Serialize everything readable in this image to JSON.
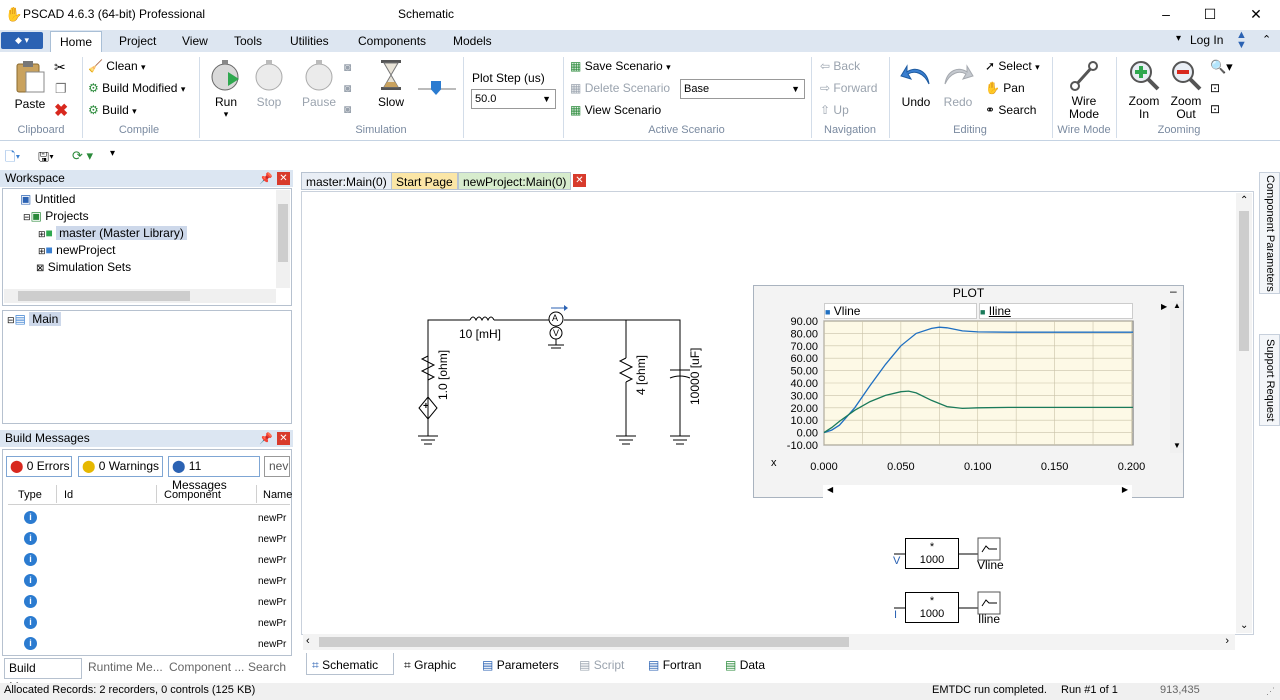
{
  "window": {
    "title": "PSCAD 4.6.3 (64-bit) Professional",
    "document": "Schematic",
    "minimize": "–",
    "maximize": "☐",
    "close": "✕"
  },
  "ribbon_tabs": [
    "Home",
    "Project",
    "View",
    "Tools",
    "Utilities",
    "Components",
    "Models"
  ],
  "login": "Log In",
  "ribbon": {
    "clipboard": {
      "paste": "Paste",
      "group": "Clipboard"
    },
    "compile": {
      "clean": "Clean",
      "build_modified": "Build Modified",
      "build": "Build",
      "group": "Compile"
    },
    "simulation": {
      "run": "Run",
      "stop": "Stop",
      "pause": "Pause",
      "slow": "Slow",
      "group": "Simulation"
    },
    "plot_step": {
      "label": "Plot Step (us)",
      "value": "50.0"
    },
    "scenario": {
      "save": "Save Scenario",
      "delete": "Delete Scenario",
      "view": "View Scenario",
      "value": "Base",
      "group": "Active Scenario"
    },
    "navigation": {
      "back": "Back",
      "forward": "Forward",
      "up": "Up",
      "group": "Navigation"
    },
    "editing": {
      "undo": "Undo",
      "redo": "Redo",
      "select": "Select",
      "pan": "Pan",
      "search": "Search",
      "group": "Editing"
    },
    "wire": {
      "label1": "Wire",
      "label2": "Mode",
      "group": "Wire Mode"
    },
    "zoom": {
      "in1": "Zoom",
      "in2": "In",
      "out1": "Zoom",
      "out2": "Out",
      "group": "Zooming"
    }
  },
  "workspace": {
    "title": "Workspace",
    "tree": {
      "root": "Untitled",
      "projects": "Projects",
      "master": "master (Master Library)",
      "newproject": "newProject",
      "sim_sets": "Simulation Sets"
    },
    "hierarchy_main": "Main"
  },
  "build_messages": {
    "title": "Build Messages",
    "errors": "0 Errors",
    "warnings": "0 Warnings",
    "messages": "11 Messages",
    "filter": "nev",
    "columns": [
      "Type",
      "Id",
      "Component",
      "Name"
    ],
    "rows": [
      "newPr",
      "newPr",
      "newPr",
      "newPr",
      "newPr",
      "newPr",
      "newPr"
    ]
  },
  "left_bottom_tabs": [
    "Build Messa...",
    "Runtime Me...",
    "Component ...",
    "Search"
  ],
  "doc_tabs": [
    "master:Main(0)",
    "Start Page",
    "newProject:Main(0)"
  ],
  "bottom_tabs": [
    "Schematic",
    "Graphic",
    "Parameters",
    "Script",
    "Fortran",
    "Data"
  ],
  "side_tabs": [
    "Component Parameters",
    "Support Request"
  ],
  "circuit": {
    "inductor": "10 [mH]",
    "r_source": "1.0 [ohm]",
    "r_load": "4 [ohm]",
    "cap": "10000 [uF]",
    "ammeter": "A",
    "voltmeter": "V",
    "mult1_top": "*",
    "mult1_val": "1000",
    "mult2_top": "*",
    "mult2_val": "1000",
    "out1": "Vline",
    "out2": "Iline"
  },
  "chart_data": {
    "type": "line",
    "title": "PLOT",
    "xlabel": "x",
    "ylabel": "",
    "xlim": [
      0,
      0.2
    ],
    "ylim": [
      -10,
      90
    ],
    "yticks": [
      "90.00",
      "80.00",
      "70.00",
      "60.00",
      "50.00",
      "40.00",
      "30.00",
      "20.00",
      "10.00",
      "0.00",
      "-10.00"
    ],
    "xticks": [
      "0.000",
      "0.050",
      "0.100",
      "0.150",
      "0.200"
    ],
    "plot_xmax": 0.201,
    "series": [
      {
        "name": "Vline",
        "color": "#1f6fc1",
        "x": [
          0,
          0.005,
          0.01,
          0.02,
          0.03,
          0.04,
          0.05,
          0.06,
          0.07,
          0.075,
          0.08,
          0.09,
          0.1,
          0.12,
          0.15,
          0.201
        ],
        "y": [
          0,
          2,
          6,
          20,
          38,
          55,
          70,
          80,
          84,
          85,
          84.5,
          82,
          81.2,
          81,
          81,
          81
        ]
      },
      {
        "name": "Iline",
        "color": "#1a7a5a",
        "x": [
          0,
          0.005,
          0.01,
          0.02,
          0.03,
          0.04,
          0.05,
          0.055,
          0.06,
          0.07,
          0.08,
          0.09,
          0.1,
          0.12,
          0.15,
          0.201
        ],
        "y": [
          0,
          4,
          9,
          18,
          25,
          30,
          33,
          33.5,
          32,
          26,
          21,
          19.5,
          20,
          20.3,
          20.3,
          20.3
        ]
      }
    ]
  },
  "status": {
    "left": "Allocated Records: 2 recorders, 0 controls (125 KB)",
    "emtdc": "EMTDC run completed.",
    "run": "Run #1 of 1",
    "coord": "913,435"
  }
}
